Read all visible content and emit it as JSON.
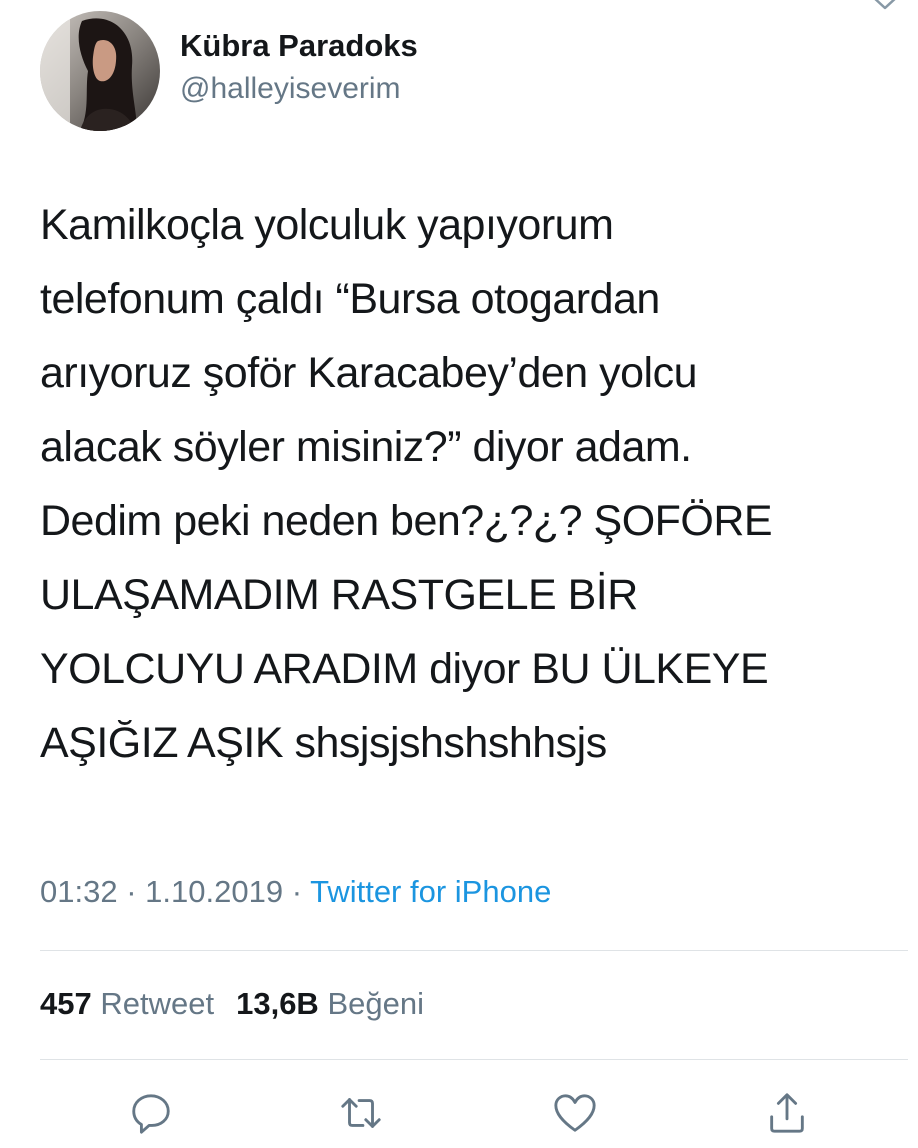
{
  "user": {
    "display_name": "Kübra Paradoks",
    "handle": "@halleyiseverim",
    "avatar_icon": "avatar"
  },
  "tweet": {
    "lines": [
      "Kamilkoçla yolculuk yapıyorum",
      "telefonum çaldı “Bursa otogardan",
      "arıyoruz şoför Karacabey’den yolcu",
      "alacak söyler misiniz?” diyor adam.",
      "Dedim peki neden ben?¿?¿? ŞOFÖRE",
      "ULAŞAMADIM RASTGELE BİR",
      "YOLCUYU ARADIM diyor BU ÜLKEYE",
      "AŞIĞIZ AŞIK shsjsjshshshhsjs"
    ]
  },
  "meta": {
    "time": "01:32",
    "separator": "·",
    "date": "1.10.2019",
    "source": "Twitter for iPhone"
  },
  "stats": {
    "retweet_count": "457",
    "retweet_label": "Retweet",
    "like_count": "13,6B",
    "like_label": "Beğeni"
  },
  "actions": {
    "icons": [
      "reply-icon",
      "retweet-icon",
      "like-icon",
      "share-icon"
    ]
  },
  "colors": {
    "text": "#14171a",
    "secondary": "#657786",
    "link": "#1b95e0",
    "divider": "#dfe3e6"
  }
}
